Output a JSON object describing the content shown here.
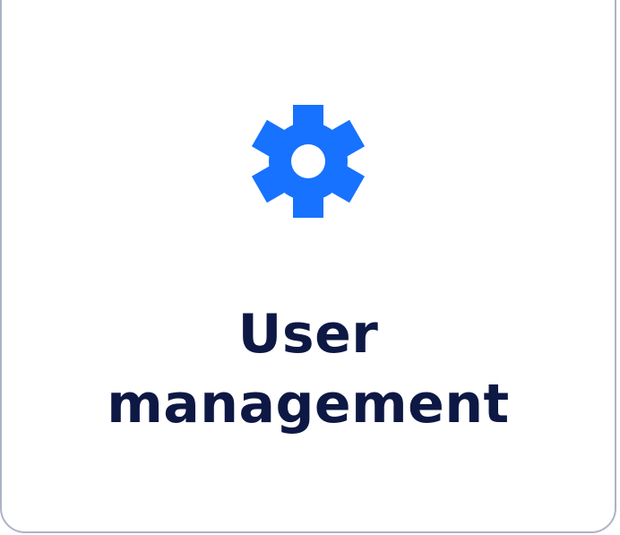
{
  "tile": {
    "icon": "gear-icon",
    "title_line1": "User",
    "title_line2": "management"
  },
  "colors": {
    "icon": "#1672ff",
    "title": "#0e1844",
    "border": "#aeb2c4",
    "background": "#ffffff"
  }
}
